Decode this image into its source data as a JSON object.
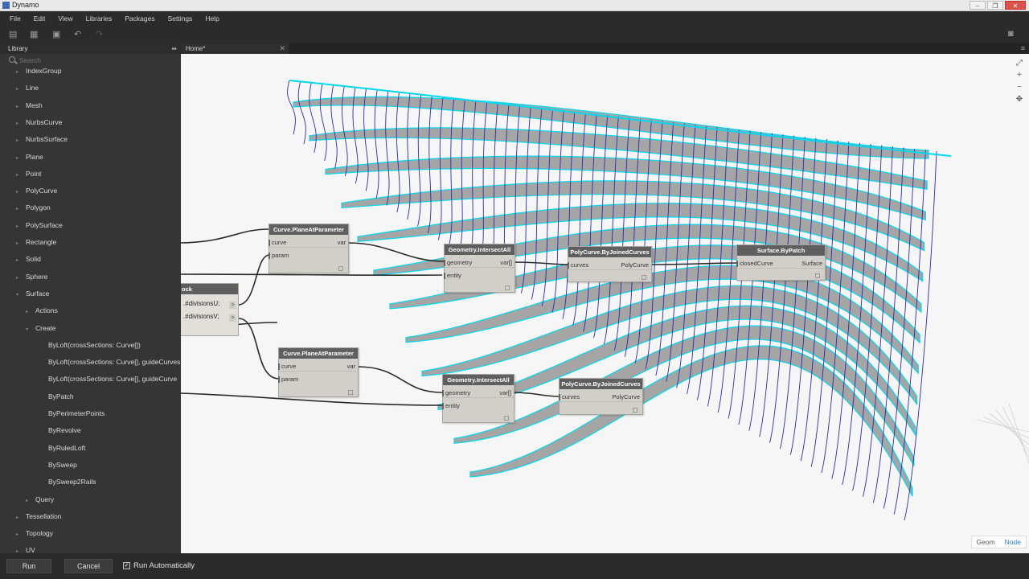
{
  "window": {
    "title": "Dynamo"
  },
  "menu": [
    "File",
    "Edit",
    "View",
    "Libraries",
    "Packages",
    "Settings",
    "Help"
  ],
  "toolbar_icons": [
    "new-file-icon",
    "open-file-icon",
    "save-icon",
    "undo-icon",
    "redo-icon",
    "camera-icon"
  ],
  "tab": {
    "label": "Home*"
  },
  "library": {
    "title": "Library",
    "search_placeholder": "Search",
    "items": [
      {
        "label": "IndexGroup",
        "level": 1,
        "arrow": "▸"
      },
      {
        "label": "Line",
        "level": 1,
        "arrow": "▸"
      },
      {
        "label": "Mesh",
        "level": 1,
        "arrow": "▸"
      },
      {
        "label": "NurbsCurve",
        "level": 1,
        "arrow": "▸"
      },
      {
        "label": "NurbsSurface",
        "level": 1,
        "arrow": "▸"
      },
      {
        "label": "Plane",
        "level": 1,
        "arrow": "▸"
      },
      {
        "label": "Point",
        "level": 1,
        "arrow": "▸"
      },
      {
        "label": "PolyCurve",
        "level": 1,
        "arrow": "▸"
      },
      {
        "label": "Polygon",
        "level": 1,
        "arrow": "▸"
      },
      {
        "label": "PolySurface",
        "level": 1,
        "arrow": "▸"
      },
      {
        "label": "Rectangle",
        "level": 1,
        "arrow": "▸"
      },
      {
        "label": "Solid",
        "level": 1,
        "arrow": "▸"
      },
      {
        "label": "Sphere",
        "level": 1,
        "arrow": "▸"
      },
      {
        "label": "Surface",
        "level": 1,
        "arrow": "▾"
      },
      {
        "label": "Actions",
        "level": 2,
        "arrow": "▸"
      },
      {
        "label": "Create",
        "level": 2,
        "arrow": "▾"
      },
      {
        "label": "ByLoft(crossSections: Curve[])",
        "level": 3,
        "arrow": ""
      },
      {
        "label": "ByLoft(crossSections: Curve[], guideCurves",
        "level": 3,
        "arrow": ""
      },
      {
        "label": "ByLoft(crossSections: Curve[], guideCurve",
        "level": 3,
        "arrow": ""
      },
      {
        "label": "ByPatch",
        "level": 3,
        "arrow": ""
      },
      {
        "label": "ByPerimeterPoints",
        "level": 3,
        "arrow": ""
      },
      {
        "label": "ByRevolve",
        "level": 3,
        "arrow": ""
      },
      {
        "label": "ByRuledLoft",
        "level": 3,
        "arrow": ""
      },
      {
        "label": "BySweep",
        "level": 3,
        "arrow": ""
      },
      {
        "label": "BySweep2Rails",
        "level": 3,
        "arrow": ""
      },
      {
        "label": "Query",
        "level": 2,
        "arrow": "▸"
      },
      {
        "label": "Tessellation",
        "level": 1,
        "arrow": "▸"
      },
      {
        "label": "Topology",
        "level": 1,
        "arrow": "▸"
      },
      {
        "label": "UV",
        "level": 1,
        "arrow": "▸"
      }
    ]
  },
  "nodes": {
    "plane_at_param_1": {
      "title": "Curve.PlaneAtParameter",
      "in1": "curve",
      "in2": "param",
      "out": "var"
    },
    "intersect_all_1": {
      "title": "Geometry.IntersectAll",
      "in1": "geometry",
      "in2": "entity",
      "out": "var[]"
    },
    "polycurve_1": {
      "title": "PolyCurve.ByJoinedCurves",
      "in1": "curves",
      "out": "PolyCurve"
    },
    "surface_patch": {
      "title": "Surface.ByPatch",
      "in1": "closedCurve",
      "out": "Surface"
    },
    "code_block": {
      "title": "ock",
      "line1": ".#divisionsU;",
      "line2": ".#divisionsV;",
      "out": ">"
    },
    "plane_at_param_2": {
      "title": "Curve.PlaneAtParameter",
      "in1": "curve",
      "in2": "param",
      "out": "var"
    },
    "intersect_all_2": {
      "title": "Geometry.IntersectAll",
      "in1": "geometry",
      "in2": "entity",
      "out": "var[]"
    },
    "polycurve_2": {
      "title": "PolyCurve.ByJoinedCurves",
      "in1": "curves",
      "out": "PolyCurve"
    }
  },
  "canvas_controls": [
    "zoom-to-fit-icon",
    "zoom-in-icon",
    "zoom-out-icon",
    "pan-icon"
  ],
  "view_toggle": {
    "geom": "Geom",
    "node": "Node"
  },
  "status": {
    "run": "Run",
    "cancel": "Cancel",
    "run_auto": "Run Automatically",
    "run_auto_checked": true
  },
  "colors": {
    "accent": "#2a7cd4",
    "wire_cyan": "#00d8f0",
    "wire_blue": "#2c2ca8",
    "node_header": "#5f5f5f"
  }
}
